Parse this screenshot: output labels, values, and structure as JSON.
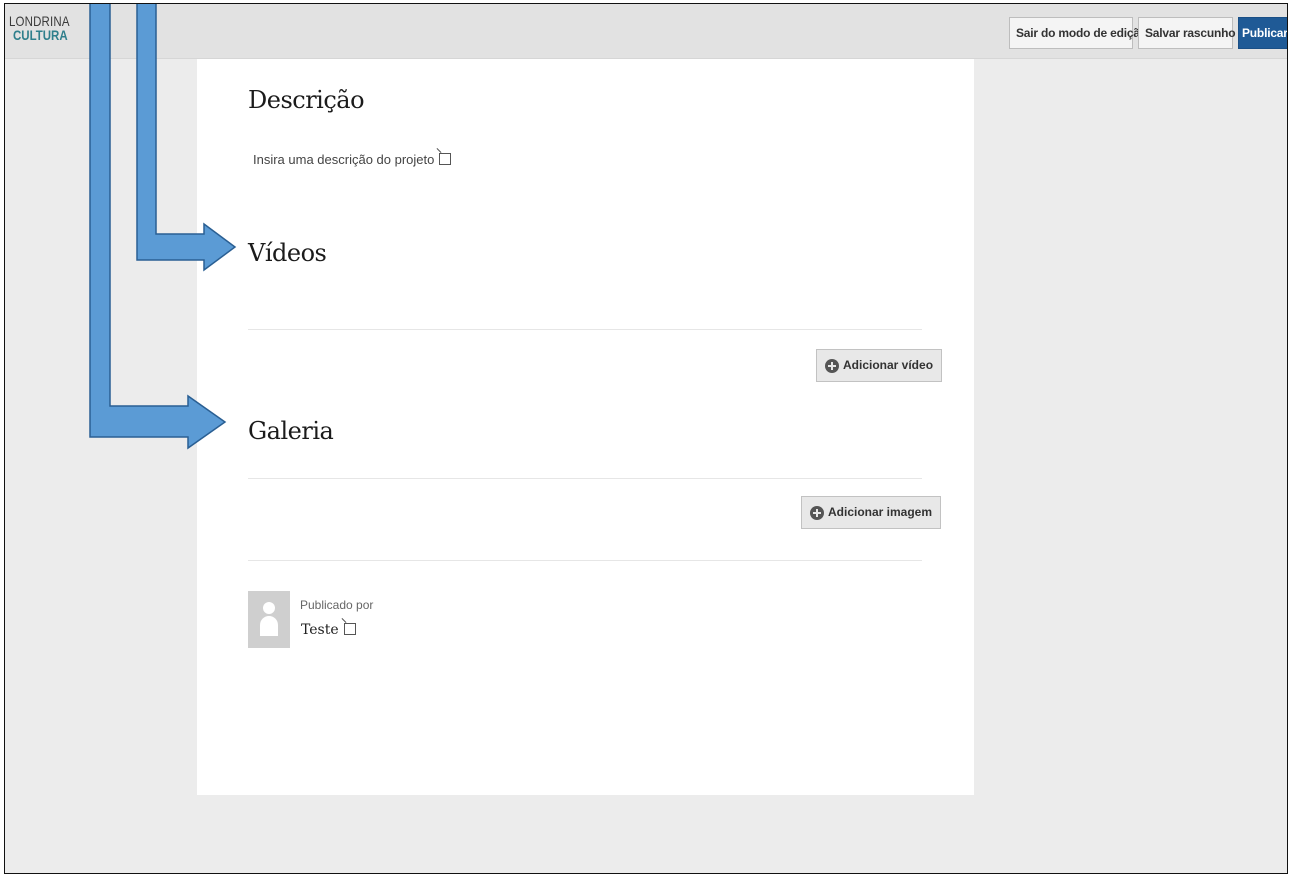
{
  "logo": {
    "line1": "LONDRINA",
    "line2": "CULTURA"
  },
  "toolbar": {
    "exit_label": "Sair do modo de edição",
    "draft_label": "Salvar rascunho",
    "publish_label": "Publicar"
  },
  "description": {
    "title": "Descrição",
    "placeholder": "Insira uma descrição do projeto"
  },
  "videos": {
    "title": "Vídeos",
    "add_label": "Adicionar vídeo"
  },
  "gallery": {
    "title": "Galeria",
    "add_label": "Adicionar imagem"
  },
  "author": {
    "label": "Publicado por",
    "name": "Teste"
  },
  "colors": {
    "publish_button": "#1f5a96",
    "logo_accent": "#2f7f8c",
    "annotation_arrow": "#5b9bd5"
  }
}
